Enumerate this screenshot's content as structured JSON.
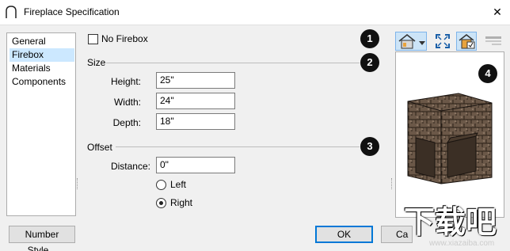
{
  "window": {
    "title": "Fireplace Specification",
    "close_glyph": "✕"
  },
  "nav": {
    "items": [
      {
        "label": "General",
        "selected": false
      },
      {
        "label": "Firebox",
        "selected": true
      },
      {
        "label": "Materials",
        "selected": false
      },
      {
        "label": "Components",
        "selected": false
      }
    ]
  },
  "firebox": {
    "no_firebox_label": "No Firebox",
    "no_firebox_checked": false,
    "size_group": "Size",
    "height_label": "Height:",
    "height_value": "25\"",
    "width_label": "Width:",
    "width_value": "24\"",
    "depth_label": "Depth:",
    "depth_value": "18\"",
    "offset_group": "Offset",
    "distance_label": "Distance:",
    "distance_value": "0\"",
    "left_label": "Left",
    "right_label": "Right",
    "selected_side": "Right"
  },
  "callouts": [
    "1",
    "2",
    "3",
    "4"
  ],
  "buttons": {
    "number_style": "Number Style...",
    "ok": "OK",
    "cancel": "Ca"
  },
  "toolbar": {
    "icons": [
      "view-type-icon",
      "dropdown-arrow-icon",
      "fill-window-icon",
      "color-toggle-icon",
      "layers-icon"
    ]
  },
  "watermark": {
    "text": "下载吧",
    "url": "www.xiazaiba.com"
  },
  "colors": {
    "selection": "#cce8ff",
    "accent": "#0078d7",
    "stone": "#5a4a3c"
  }
}
